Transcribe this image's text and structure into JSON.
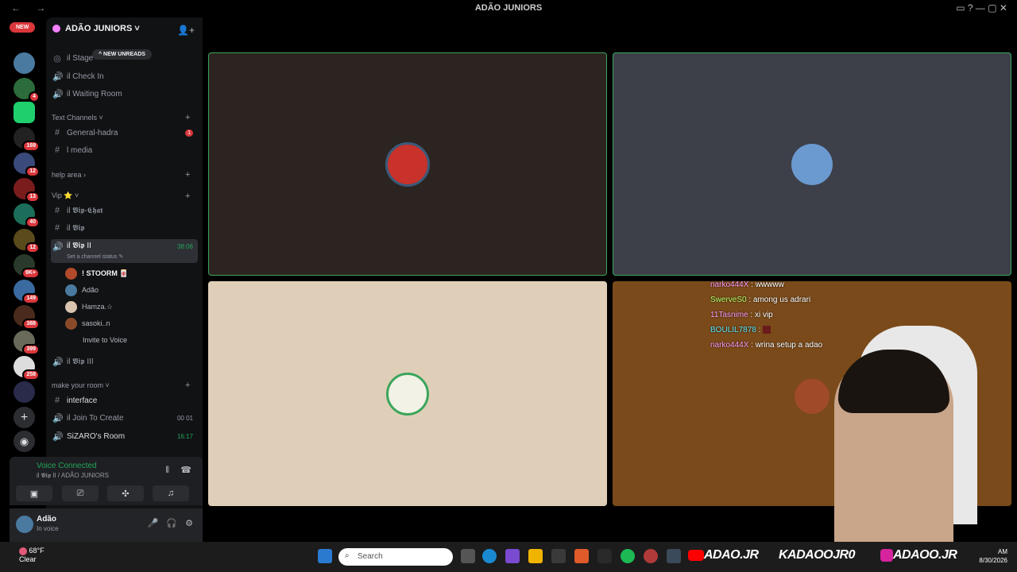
{
  "window": {
    "title": "ADÃO JUNIORS",
    "nav": "← →",
    "controls": "▭ ? — ▢ ✕"
  },
  "servers": {
    "new_label": "NEW",
    "badges": [
      "4",
      "169",
      "12",
      "13",
      "40",
      "12",
      "9K+",
      "149",
      "388",
      "399",
      "258"
    ]
  },
  "server_header": {
    "name": "ADÃO JUNIORS ˅",
    "new_unreads": "^ NEW UNREADS"
  },
  "channels": {
    "stage": "il Stage",
    "check_in": "il Check In",
    "waiting": "il Waiting Room",
    "text_cat": "Text Channels ˅",
    "general": "General-hadra",
    "general_badge": "1",
    "media": "l media",
    "help_cat": "help area ›",
    "vip_cat": "Vip ⭐ ˅",
    "vip_chat": "il 𝖁𝖎𝖕-𝕮𝖍𝖆𝖙",
    "vip": "il 𝖁𝖎𝖕",
    "vip2": "il 𝖁𝖎𝖕 II",
    "vip2_time": "38:06",
    "vip2_status": "Set a channel status ✎",
    "users": [
      "! STOORM 🀄",
      "Adão",
      "Hamza.☆",
      "sasoki..n"
    ],
    "invite": "Invite to Voice",
    "vip3": "il 𝖁𝖎𝖕 III",
    "room_cat": "make your room ˅",
    "interface": "interface",
    "join": "il Join To Create",
    "join_counts": "00 01",
    "sizaro": "SiZARO's Room",
    "sizaro_time": "16:17",
    "sizaro_user": "Adão"
  },
  "voice": {
    "status": "Voice Connected",
    "location": "il 𝖁𝖎𝖕 II / ADÃO JUNIORS"
  },
  "me": {
    "name": "Adão",
    "status": "In voice"
  },
  "chat": [
    {
      "user": "narko444X",
      "msg": " : wwwww",
      "color": "#ff9cf5"
    },
    {
      "user": "SwerveS0",
      "msg": " : among us adrari",
      "color": "#b6ff6b"
    },
    {
      "user": "11Tasnime",
      "msg": " : xi vip",
      "color": "#ff9cf5"
    },
    {
      "user": "BOULIL7878",
      "msg": " : ",
      "color": "#5ee9ff"
    },
    {
      "user": "narko444X",
      "msg": " : wrina setup a adao",
      "color": "#ff9cf5"
    }
  ],
  "taskbar": {
    "weather_temp": "68°F",
    "weather_desc": "Clear",
    "search": "Search",
    "brand1": "ADAO.JR",
    "brand2": "KADAOOJR0",
    "brand3": "ADAOO.JR",
    "clock_ampm": "AM",
    "clock_date": "8/30/2026"
  }
}
